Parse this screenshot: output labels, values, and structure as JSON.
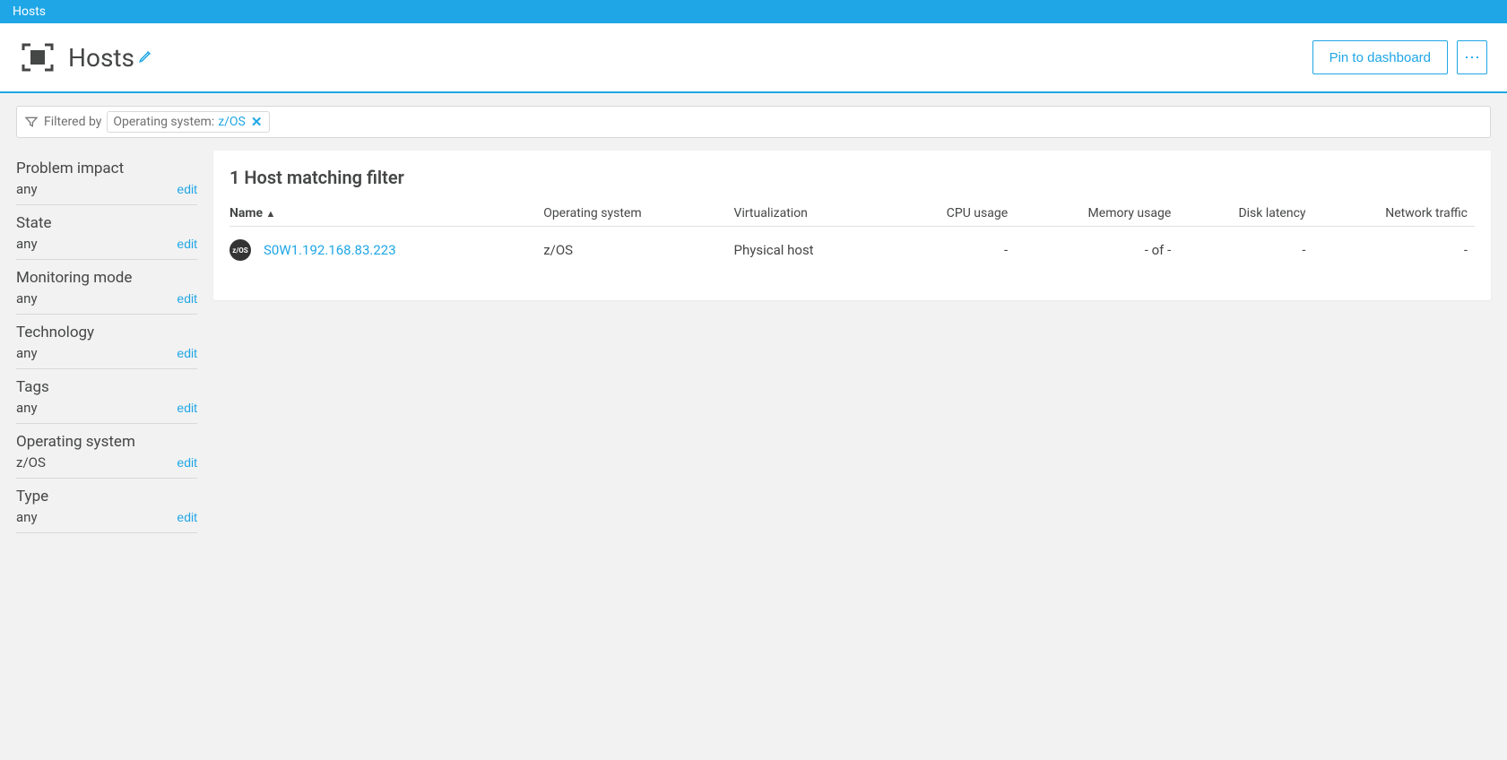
{
  "topbar": {
    "title": "Hosts"
  },
  "header": {
    "title": "Hosts",
    "pin_label": "Pin to dashboard",
    "more_label": "⋯"
  },
  "filter": {
    "filtered_by_label": "Filtered by",
    "chip": {
      "label": "Operating system:",
      "value": "z/OS"
    }
  },
  "sidebar": {
    "groups": [
      {
        "title": "Problem impact",
        "value": "any",
        "action": "edit"
      },
      {
        "title": "State",
        "value": "any",
        "action": "edit"
      },
      {
        "title": "Monitoring mode",
        "value": "any",
        "action": "edit"
      },
      {
        "title": "Technology",
        "value": "any",
        "action": "edit"
      },
      {
        "title": "Tags",
        "value": "any",
        "action": "edit"
      },
      {
        "title": "Operating system",
        "value": "z/OS",
        "action": "edit"
      },
      {
        "title": "Type",
        "value": "any",
        "action": "edit"
      }
    ]
  },
  "main": {
    "heading": "1 Host matching filter",
    "columns": {
      "name": "Name",
      "sort_indicator": "▲",
      "os": "Operating system",
      "virt": "Virtualization",
      "cpu": "CPU usage",
      "mem": "Memory usage",
      "disk": "Disk latency",
      "net": "Network traffic"
    },
    "rows": [
      {
        "badge": "z/OS",
        "name": "S0W1.192.168.83.223",
        "os": "z/OS",
        "virt": "Physical host",
        "cpu": "-",
        "mem": "- of -",
        "disk": "-",
        "net": "-"
      }
    ]
  }
}
